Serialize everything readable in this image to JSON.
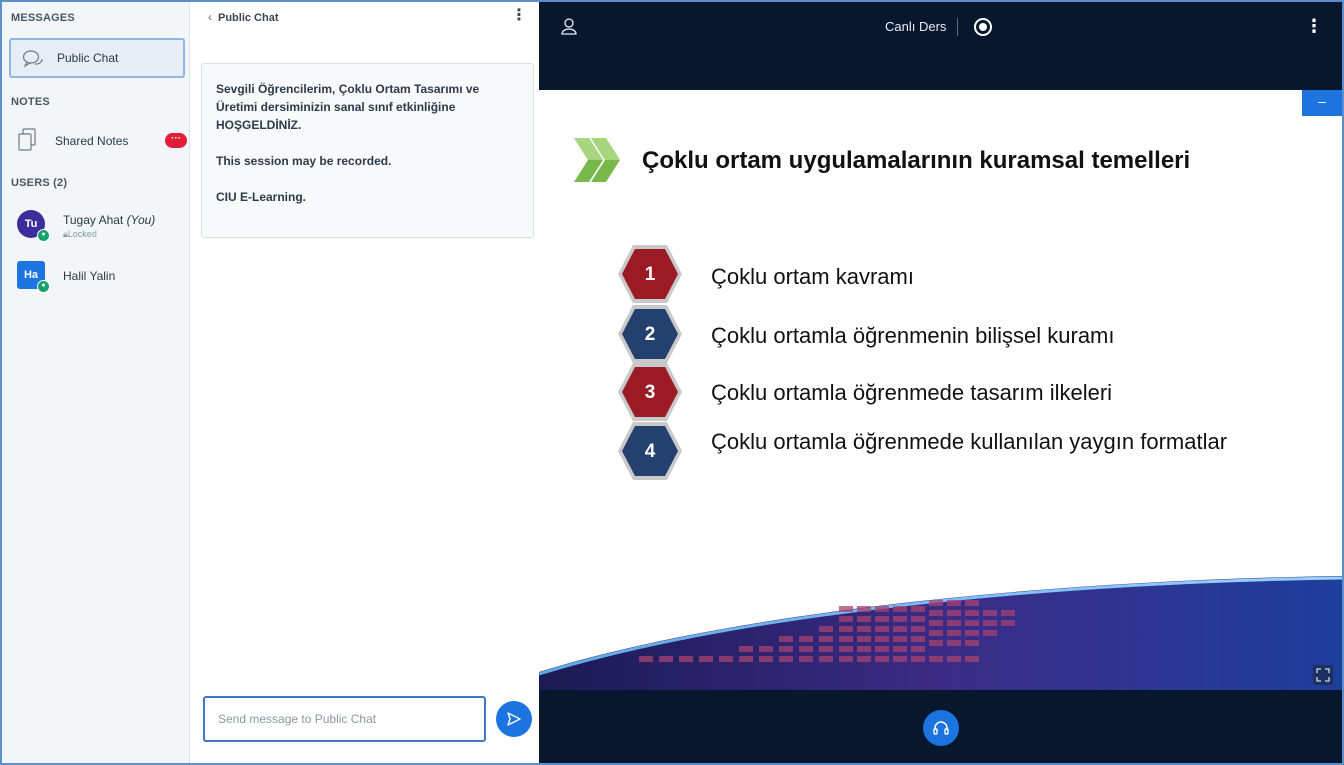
{
  "sidebar": {
    "messages_title": "MESSAGES",
    "public_chat_label": "Public Chat",
    "notes_title": "NOTES",
    "shared_notes_label": "Shared Notes",
    "shared_notes_badge": "···",
    "users_title": "USERS (2)",
    "users": [
      {
        "initials": "Tu",
        "name": "Tugay Ahat",
        "you": "(You)",
        "status": "Locked",
        "color": "#3b2e9b"
      },
      {
        "initials": "Ha",
        "name": "Halil Yalin",
        "you": "",
        "status": "",
        "color": "#1b74e0"
      }
    ]
  },
  "chat": {
    "title": "Public Chat",
    "welcome": {
      "line1": "Sevgili Öğrencilerim, Çoklu Ortam Tasarımı ve Üretimi dersiminizin sanal sınıf etkinliğine HOŞGELDİNİZ.",
      "line2": "This session may be recorded.",
      "line3": "CIU E-Learning."
    },
    "input_placeholder": "Send message to Public Chat"
  },
  "stage": {
    "title": "Canlı Ders",
    "slide": {
      "title": "Çoklu ortam uygulamalarının kuramsal temelleri",
      "items": [
        {
          "num": "1",
          "text": "Çoklu ortam kavramı",
          "color": "#9b1b25"
        },
        {
          "num": "2",
          "text": "Çoklu ortamla öğrenmenin bilişsel kuramı",
          "color": "#24406f"
        },
        {
          "num": "3",
          "text": "Çoklu ortamla öğrenmede tasarım ilkeleri",
          "color": "#9b1b25"
        },
        {
          "num": "4",
          "text": "Çoklu ortamla öğrenmede kullanılan yaygın formatlar",
          "color": "#24406f"
        }
      ]
    }
  },
  "colors": {
    "accent": "#1b74e0",
    "stage_bg": "#07172d",
    "badge": "#e01e37"
  }
}
